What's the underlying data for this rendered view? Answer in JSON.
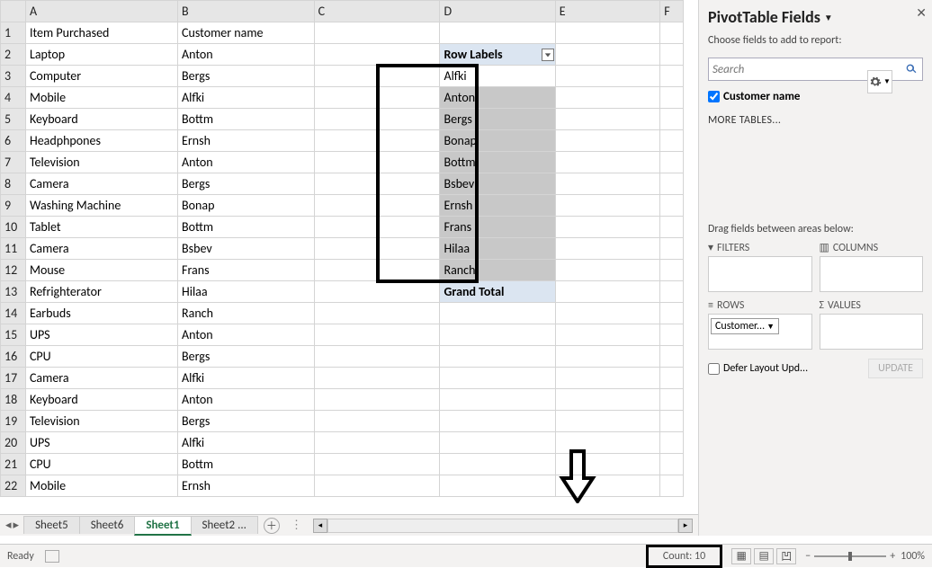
{
  "columns": [
    "A",
    "B",
    "C",
    "D",
    "E",
    "F"
  ],
  "data_rows": [
    {
      "n": 1,
      "A": "Item Purchased",
      "B": "Customer name"
    },
    {
      "n": 2,
      "A": "Laptop",
      "B": "Anton"
    },
    {
      "n": 3,
      "A": "Computer",
      "B": "Bergs"
    },
    {
      "n": 4,
      "A": "Mobile",
      "B": "Alfki"
    },
    {
      "n": 5,
      "A": "Keyboard",
      "B": "Bottm"
    },
    {
      "n": 6,
      "A": "Headphpones",
      "B": "Ernsh"
    },
    {
      "n": 7,
      "A": "Television",
      "B": "Anton"
    },
    {
      "n": 8,
      "A": "Camera",
      "B": "Bergs"
    },
    {
      "n": 9,
      "A": "Washing Machine",
      "B": "Bonap"
    },
    {
      "n": 10,
      "A": "Tablet",
      "B": "Bottm"
    },
    {
      "n": 11,
      "A": "Camera",
      "B": "Bsbev"
    },
    {
      "n": 12,
      "A": "Mouse",
      "B": "Frans"
    },
    {
      "n": 13,
      "A": "Refrighterator",
      "B": "Hilaa"
    },
    {
      "n": 14,
      "A": "Earbuds",
      "B": "Ranch"
    },
    {
      "n": 15,
      "A": "UPS",
      "B": "Anton"
    },
    {
      "n": 16,
      "A": "CPU",
      "B": "Bergs"
    },
    {
      "n": 17,
      "A": "Camera",
      "B": "Alfki"
    },
    {
      "n": 18,
      "A": "Keyboard",
      "B": "Anton"
    },
    {
      "n": 19,
      "A": "Television",
      "B": "Bergs"
    },
    {
      "n": 20,
      "A": "UPS",
      "B": "Alfki"
    },
    {
      "n": 21,
      "A": "CPU",
      "B": "Bottm"
    },
    {
      "n": 22,
      "A": "Mobile",
      "B": "Ernsh"
    }
  ],
  "pivot": {
    "header": "Row Labels",
    "rows": [
      "Alfki",
      "Anton",
      "Bergs",
      "Bonap",
      "Bottm",
      "Bsbev",
      "Ernsh",
      "Frans",
      "Hilaa",
      "Ranch"
    ],
    "grand_total": "Grand Total"
  },
  "sheets": {
    "tabs": [
      "Sheet5",
      "Sheet6",
      "Sheet1",
      "Sheet2 ..."
    ],
    "active": "Sheet1"
  },
  "panel": {
    "title": "PivotTable Fields",
    "subtitle": "Choose fields to add to report:",
    "search_placeholder": "Search",
    "field": "Customer name",
    "more_tables": "MORE TABLES...",
    "drag_label": "Drag fields between areas below:",
    "areas": {
      "filters": "FILTERS",
      "columns": "COLUMNS",
      "rows": "ROWS",
      "values": "VALUES"
    },
    "rows_chip": "Customer...",
    "defer": "Defer Layout Upd...",
    "update": "UPDATE"
  },
  "status": {
    "ready": "Ready",
    "count_label": "Count: 10",
    "zoom": "100%"
  }
}
